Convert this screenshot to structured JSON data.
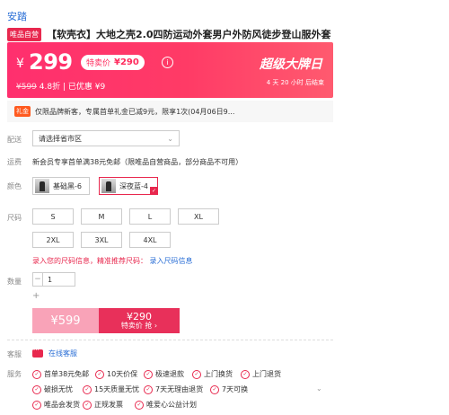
{
  "brand": "安踏",
  "product": {
    "tag": "唯品自营",
    "title": "【软壳衣】大地之壳2.0四防运动外套男户外防风徒步登山服外套"
  },
  "price": {
    "currency": "¥",
    "current": "299",
    "tehui_label": "特卖价",
    "tehui_price": "¥290",
    "info_icon": "ⓘ",
    "original": "¥599",
    "discount": "4.8折",
    "saved": "已优惠 ¥9",
    "sub_separator": "|",
    "super_label": "超级大牌日",
    "countdown": "4 天 20 小时 后结束"
  },
  "coupon": {
    "badge": "礼金",
    "text": "仅限品牌新客，专属首单礼金已减9元，限享1次(04月06日9..."
  },
  "labels": {
    "ship": "配送",
    "freight": "运费",
    "color": "颜色",
    "size": "尺码",
    "qty": "数量",
    "service_chat": "客服",
    "service": "服务"
  },
  "shipping": {
    "placeholder": "请选择省市区",
    "freight_text": "新会员专享首单满38元免邮（限唯品自营商品，部分商品不可用）"
  },
  "colors": [
    {
      "name": "基础黑-6",
      "selected": false
    },
    {
      "name": "深夜蓝-4",
      "selected": true
    }
  ],
  "sizes": [
    "S",
    "M",
    "L",
    "XL",
    "2XL",
    "3XL",
    "4XL"
  ],
  "size_tip": {
    "text": "录入您的尺码信息，精准推荐尺码：",
    "link": "录入尺码信息"
  },
  "quantity": {
    "minus": "−",
    "value": "1",
    "plus": "+"
  },
  "buy": {
    "original_label": "¥599",
    "price": "¥290",
    "action": "特卖价 抢 ›"
  },
  "chat_link": "在线客服",
  "services": [
    "首单38元免邮",
    "10天价保",
    "极速退款",
    "上门换货",
    "上门退货",
    "破损无忧",
    "15天质量无忧",
    "7天无理由退货",
    "7天可换",
    "唯品会发货",
    "正规发票",
    "唯爱心公益计划"
  ],
  "colors_theme": {
    "accent": "#e8284e",
    "link": "#2b6fd6"
  }
}
